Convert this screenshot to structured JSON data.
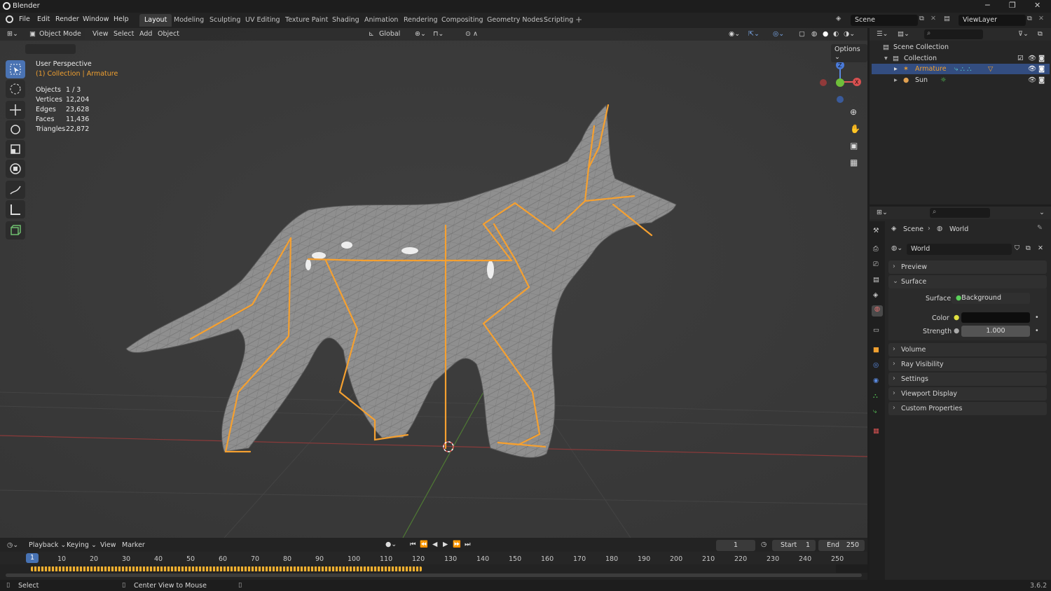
{
  "app": {
    "title": "Blender",
    "version": "3.6.2"
  },
  "menu": [
    "File",
    "Edit",
    "Render",
    "Window",
    "Help"
  ],
  "workspaces": [
    "Layout",
    "Modeling",
    "Sculpting",
    "UV Editing",
    "Texture Paint",
    "Shading",
    "Animation",
    "Rendering",
    "Compositing",
    "Geometry Nodes",
    "Scripting"
  ],
  "active_workspace": "Layout",
  "scene_name": "Scene",
  "view_layer": "ViewLayer",
  "viewport_header": {
    "mode": "Object Mode",
    "menus": [
      "View",
      "Select",
      "Add",
      "Object"
    ],
    "orientation": "Global",
    "options": "Options"
  },
  "overlay": {
    "perspective": "User Perspective",
    "context": "(1) Collection | Armature",
    "stats": [
      {
        "label": "Objects",
        "value": "1 / 3"
      },
      {
        "label": "Vertices",
        "value": "12,204"
      },
      {
        "label": "Edges",
        "value": "23,628"
      },
      {
        "label": "Faces",
        "value": "11,436"
      },
      {
        "label": "Triangles",
        "value": "22,872"
      }
    ]
  },
  "gizmo": {
    "z": "Z",
    "x": "X"
  },
  "outliner": {
    "root": "Scene Collection",
    "collection": "Collection",
    "items": [
      {
        "name": "Armature",
        "selected": true
      },
      {
        "name": "Sun",
        "selected": false
      }
    ]
  },
  "properties": {
    "breadcrumb": [
      "Scene",
      "World"
    ],
    "datablock": "World",
    "panels": {
      "preview": "Preview",
      "surface": "Surface",
      "volume": "Volume",
      "ray_visibility": "Ray Visibility",
      "settings": "Settings",
      "viewport_display": "Viewport Display",
      "custom_properties": "Custom Properties"
    },
    "surface_label": "Surface",
    "surface_value": "Background",
    "color_label": "Color",
    "strength_label": "Strength",
    "strength_value": "1.000"
  },
  "timeline": {
    "menus": [
      "Playback",
      "Keying",
      "View",
      "Marker"
    ],
    "current_frame": "1",
    "start_label": "Start",
    "start": "1",
    "end_label": "End",
    "end": "250",
    "ticks": [
      "10",
      "20",
      "30",
      "40",
      "50",
      "60",
      "70",
      "80",
      "90",
      "100",
      "110",
      "120",
      "130",
      "140",
      "150",
      "160",
      "170",
      "180",
      "190",
      "200",
      "210",
      "220",
      "230",
      "240",
      "250"
    ],
    "playhead": "1"
  },
  "status": {
    "select": "Select",
    "center": "Center View to Mouse"
  },
  "colors": {
    "accent": "#4772b3",
    "bone": "#f5a030",
    "selected_text": "#f0a030"
  }
}
